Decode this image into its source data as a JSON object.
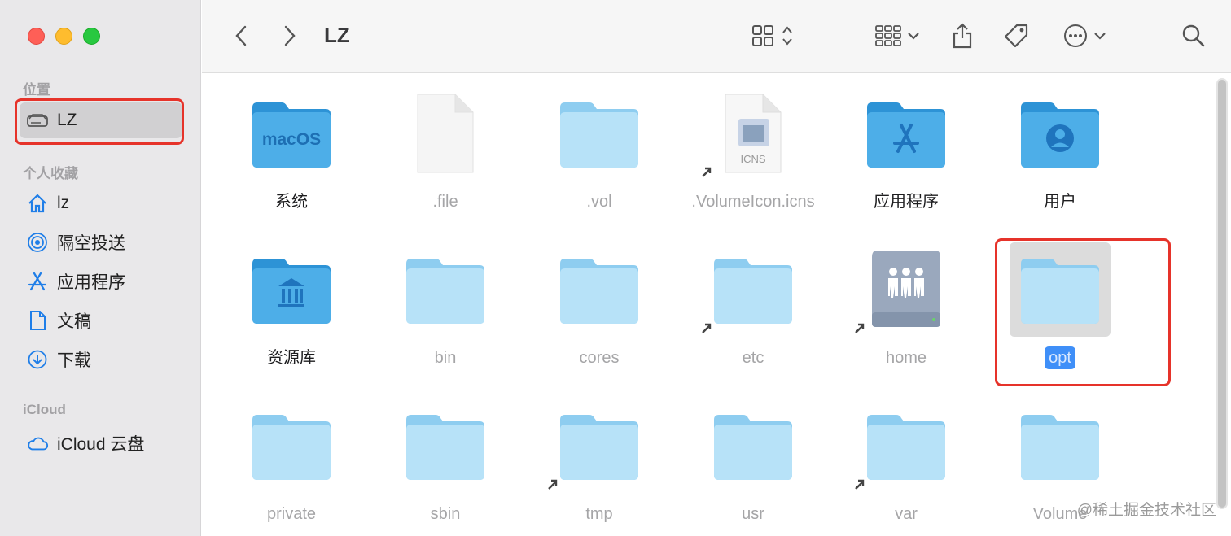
{
  "window": {
    "path_title": "LZ"
  },
  "sidebar": {
    "sections": [
      {
        "title": "位置",
        "items": [
          {
            "label": "LZ",
            "icon": "drive-icon"
          }
        ]
      },
      {
        "title": "个人收藏",
        "items": [
          {
            "label": "lz",
            "icon": "home-icon"
          },
          {
            "label": "隔空投送",
            "icon": "airdrop-icon"
          },
          {
            "label": "应用程序",
            "icon": "applications-icon"
          },
          {
            "label": "文稿",
            "icon": "document-icon"
          },
          {
            "label": "下载",
            "icon": "download-icon"
          }
        ]
      },
      {
        "title": "iCloud",
        "items": [
          {
            "label": "iCloud 云盘",
            "icon": "icloud-icon"
          }
        ]
      }
    ]
  },
  "toolbar": {
    "title": "LZ"
  },
  "files": [
    {
      "name": "系统",
      "type": "folder-macos",
      "dim": false,
      "alias": false,
      "badge": "macOS"
    },
    {
      "name": ".file",
      "type": "file",
      "dim": true,
      "alias": false
    },
    {
      "name": ".vol",
      "type": "folder",
      "dim": true,
      "alias": false
    },
    {
      "name": ".VolumeIcon.icns",
      "type": "icns",
      "dim": true,
      "alias": true,
      "badge": "ICNS"
    },
    {
      "name": "应用程序",
      "type": "folder-apps",
      "dim": false,
      "alias": false
    },
    {
      "name": "用户",
      "type": "folder-users",
      "dim": false,
      "alias": false
    },
    {
      "name": "资源库",
      "type": "folder-library",
      "dim": false,
      "alias": false
    },
    {
      "name": "bin",
      "type": "folder",
      "dim": true,
      "alias": false
    },
    {
      "name": "cores",
      "type": "folder",
      "dim": true,
      "alias": false
    },
    {
      "name": "etc",
      "type": "folder",
      "dim": true,
      "alias": true
    },
    {
      "name": "home",
      "type": "drive-home",
      "dim": true,
      "alias": true
    },
    {
      "name": "opt",
      "type": "folder",
      "dim": true,
      "alias": false,
      "selected": true
    },
    {
      "name": "private",
      "type": "folder",
      "dim": true,
      "alias": false
    },
    {
      "name": "sbin",
      "type": "folder",
      "dim": true,
      "alias": false
    },
    {
      "name": "tmp",
      "type": "folder",
      "dim": true,
      "alias": true
    },
    {
      "name": "usr",
      "type": "folder",
      "dim": true,
      "alias": false
    },
    {
      "name": "var",
      "type": "folder",
      "dim": true,
      "alias": true
    },
    {
      "name": "Volume",
      "type": "folder",
      "dim": true,
      "alias": false
    }
  ],
  "watermark": "@稀土掘金技术社区",
  "colors": {
    "highlight_box": "#e6332a",
    "selection": "#3f8ff8",
    "folder": "#a8d8f5"
  }
}
